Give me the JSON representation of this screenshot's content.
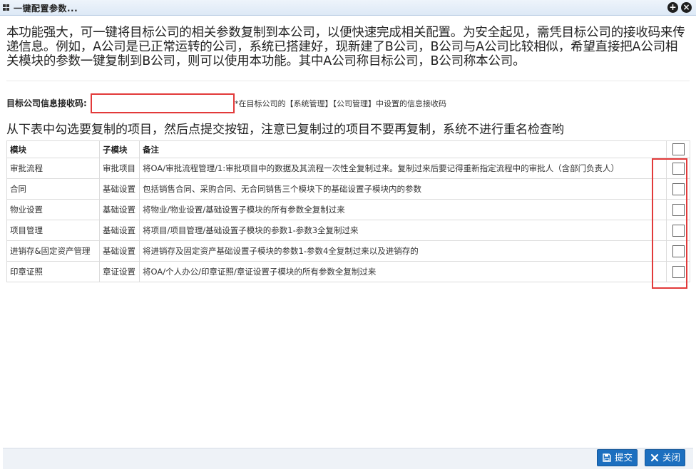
{
  "window": {
    "title": "一键配置参数...",
    "add_icon": "plus-circle-icon",
    "close_icon": "close-circle-icon"
  },
  "intro": {
    "text": "本功能强大，可一键将目标公司的相关参数复制到本公司，以便快速完成相关配置。为安全起见，需凭目标公司的接收码来传递信息。例如，A公司是已正常运转的公司，系统已搭建好，现新建了B公司，B公司与A公司比较相似，希望直接把A公司相关模块的参数一键复制到B公司，则可以使用本功能。其中A公司称目标公司，B公司称本公司。"
  },
  "code_field": {
    "label": "目标公司信息接收码:",
    "value": "",
    "placeholder": "",
    "hint": "*在目标公司的【系统管理】【公司管理】中设置的信息接收码"
  },
  "instruction": "从下表中勾选要复制的项目，然后点提交按钮，注意已复制过的项目不要再复制，系统不进行重名检查哟",
  "table": {
    "headers": [
      "模块",
      "子模块",
      "备注"
    ],
    "rows": [
      {
        "module": "审批流程",
        "sub": "审批项目",
        "note": "将OA/审批流程管理/1:审批项目中的数据及其流程一次性全复制过来。复制过来后要记得重新指定流程中的审批人（含部门负责人）",
        "checked": false
      },
      {
        "module": "合同",
        "sub": "基础设置",
        "note": "包括销售合同、采购合同、无合同销售三个模块下的基础设置子模块内的参数",
        "checked": false
      },
      {
        "module": "物业设置",
        "sub": "基础设置",
        "note": "将物业/物业设置/基础设置子模块的所有参数全复制过来",
        "checked": false
      },
      {
        "module": "项目管理",
        "sub": "基础设置",
        "note": "将项目/项目管理/基础设置子模块的参数1-参数3全复制过来",
        "checked": false
      },
      {
        "module": "进销存&固定资产管理",
        "sub": "基础设置",
        "note": "将进销存及固定资产基础设置子模块的参数1-参数4全复制过来以及进销存的",
        "checked": false
      },
      {
        "module": "印章证照",
        "sub": "章证设置",
        "note": "将OA/个人办公/印章证照/章证设置子模块的所有参数全复制过来",
        "checked": false
      }
    ]
  },
  "footer": {
    "submit_label": "提交",
    "close_label": "关闭",
    "submit_icon": "save-icon",
    "close_icon": "x-icon"
  },
  "colors": {
    "primary_button": "#1c6fbf",
    "highlight": "#e23a3a"
  }
}
